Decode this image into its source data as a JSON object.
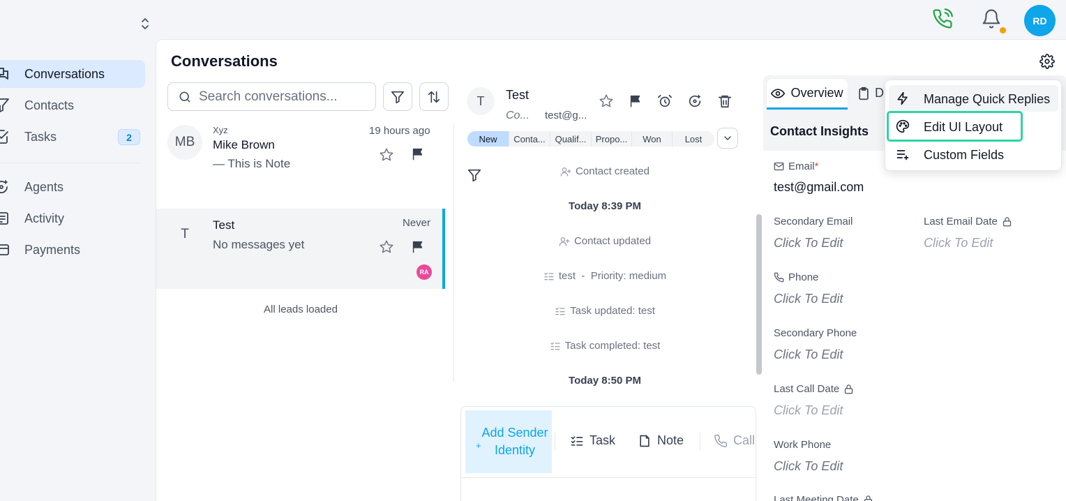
{
  "topbar": {
    "avatar_initials": "RD",
    "icons": [
      "chevron-updown-icon",
      "phone-icon",
      "bell-icon",
      "user-avatar"
    ],
    "notification_dot_color": "#f59e0b"
  },
  "sidebar": {
    "items": [
      {
        "label": "Conversations",
        "icon": "conversations-icon",
        "active": true
      },
      {
        "label": "Contacts",
        "icon": "filter-icon"
      },
      {
        "label": "Tasks",
        "icon": "checkbox-icon",
        "badge": "2"
      },
      {
        "label": "Agents",
        "icon": "agent-icon"
      },
      {
        "label": "Activity",
        "icon": "activity-icon"
      },
      {
        "label": "Payments",
        "icon": "card-icon"
      }
    ]
  },
  "main": {
    "title": "Conversations"
  },
  "search": {
    "placeholder": "Search conversations..."
  },
  "conversations": [
    {
      "initials": "MB",
      "company": "Xyz",
      "name": "Mike Brown",
      "preview": "—  This is Note",
      "time": "19 hours ago"
    },
    {
      "initials": "T",
      "name": "Test",
      "preview": "No messages yet",
      "time": "Never",
      "assignee": "RA",
      "selected": true
    }
  ],
  "list_footer": "All leads loaded",
  "detail": {
    "initials": "T",
    "name": "Test",
    "company": "Co...",
    "email": "test@g...",
    "stages": [
      {
        "label": "New",
        "active": true
      },
      {
        "label": "Conta..."
      },
      {
        "label": "Qualif..."
      },
      {
        "label": "Propo..."
      },
      {
        "label": "Won"
      },
      {
        "label": "Lost"
      }
    ],
    "timeline": [
      {
        "kind": "event",
        "icon": "user-plus-icon",
        "text": "Contact created"
      },
      {
        "kind": "date",
        "text": "Today 8:39 PM"
      },
      {
        "kind": "event",
        "icon": "user-plus-icon",
        "text": "Contact updated"
      },
      {
        "kind": "event",
        "icon": "list-check-icon",
        "text": "test  -  Priority: medium"
      },
      {
        "kind": "event",
        "icon": "list-check-icon",
        "text": "Task updated: test"
      },
      {
        "kind": "event",
        "icon": "list-check-icon",
        "text": "Task completed: test"
      },
      {
        "kind": "date",
        "text": "Today 8:50 PM"
      }
    ],
    "composer": {
      "add_identity": "Add Sender Identity",
      "task": "Task",
      "note": "Note",
      "call": "Call"
    }
  },
  "right_panel": {
    "tabs": {
      "overview": "Overview",
      "details": "D"
    },
    "insights_title": "Contact Insights",
    "fields": {
      "email_label": "Email",
      "email_required": "*",
      "email_value": "test@gmail.com",
      "secondary_email_label": "Secondary Email",
      "last_email_date_label": "Last Email Date",
      "phone_label": "Phone",
      "secondary_phone_label": "Secondary Phone",
      "last_call_date_label": "Last Call Date",
      "work_phone_label": "Work Phone",
      "last_meeting_date_label": "Last Meeting Date",
      "click_to_edit": "Click To Edit"
    }
  },
  "settings_menu": {
    "items": [
      {
        "label": "Manage Quick Replies",
        "icon": "bolt-icon"
      },
      {
        "label": "Edit UI Layout",
        "icon": "palette-icon",
        "highlighted": true
      },
      {
        "label": "Custom Fields",
        "icon": "list-plus-icon"
      }
    ]
  },
  "colors": {
    "accent": "#0ea5e9",
    "active_nav": "#dbeafe",
    "highlight_outline": "#2dd4a7",
    "phone_green": "#22a447",
    "assignee_badge": "#ec4899"
  }
}
